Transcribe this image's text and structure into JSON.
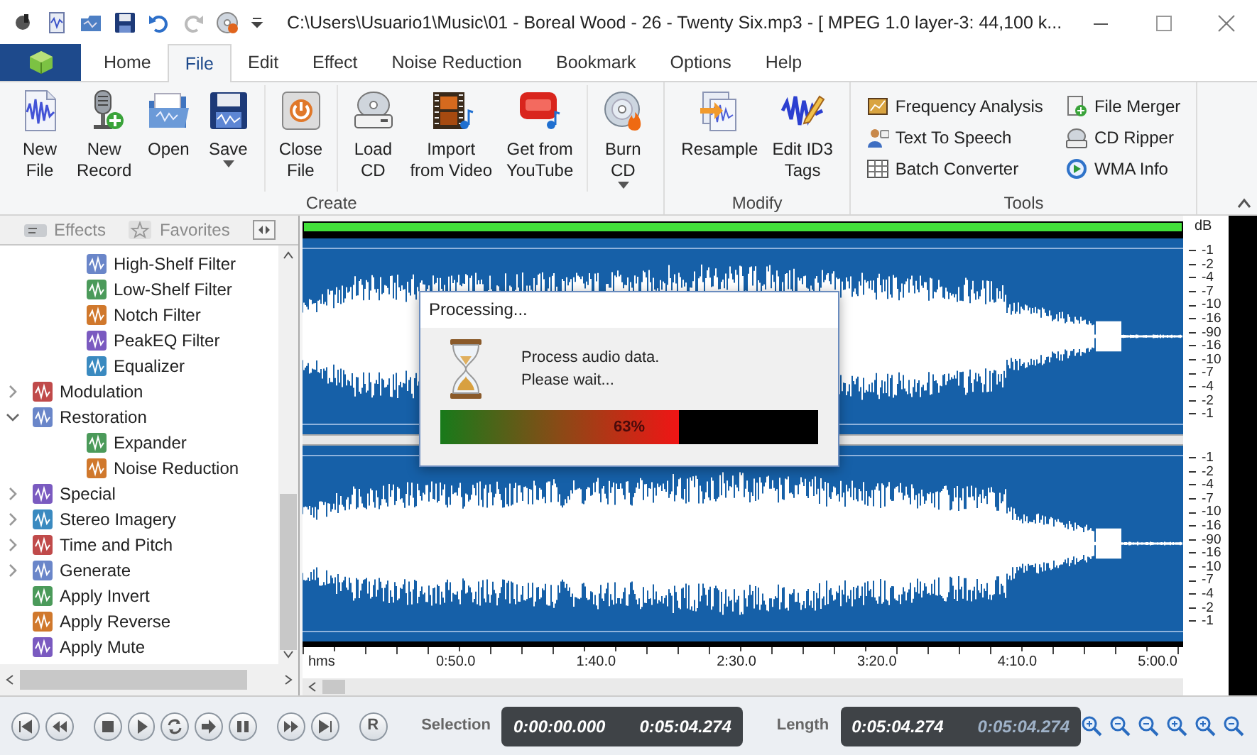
{
  "window": {
    "title": "C:\\Users\\Usuario1\\Music\\01 - Boreal Wood - 26 - Twenty Six.mp3 - [ MPEG 1.0 layer-3: 44,100 k..."
  },
  "tabs": [
    {
      "label": "Home",
      "selected": false
    },
    {
      "label": "File",
      "selected": true
    },
    {
      "label": "Edit",
      "selected": false
    },
    {
      "label": "Effect",
      "selected": false
    },
    {
      "label": "Noise Reduction",
      "selected": false
    },
    {
      "label": "Bookmark",
      "selected": false
    },
    {
      "label": "Options",
      "selected": false
    },
    {
      "label": "Help",
      "selected": false
    }
  ],
  "ribbon": {
    "groups": [
      {
        "label": "Create",
        "sections": [
          [
            {
              "kind": "new-file",
              "lines": [
                "New",
                "File"
              ],
              "dropdown": false
            },
            {
              "kind": "microphone",
              "lines": [
                "New",
                "Record"
              ],
              "dropdown": false
            },
            {
              "kind": "folder",
              "lines": [
                "Open"
              ],
              "dropdown": false
            },
            {
              "kind": "floppy",
              "lines": [
                "Save"
              ],
              "dropdown": true
            }
          ],
          [
            {
              "kind": "power",
              "lines": [
                "Close",
                "File"
              ],
              "dropdown": false
            }
          ],
          [
            {
              "kind": "cd-drive",
              "lines": [
                "Load",
                "CD"
              ],
              "dropdown": false
            },
            {
              "kind": "film",
              "lines": [
                "Import",
                "from Video"
              ],
              "dropdown": false
            },
            {
              "kind": "tube",
              "lines": [
                "Get from",
                "YouTube"
              ],
              "dropdown": false
            }
          ],
          [
            {
              "kind": "burn",
              "lines": [
                "Burn",
                "CD"
              ],
              "dropdown": true
            }
          ]
        ]
      },
      {
        "label": "Modify",
        "sections": [
          [
            {
              "kind": "resample",
              "lines": [
                "Resample"
              ],
              "dropdown": false
            },
            {
              "kind": "tag",
              "lines": [
                "Edit ID3",
                "Tags"
              ],
              "dropdown": false
            }
          ]
        ]
      },
      {
        "label": "Tools",
        "columns": [
          [
            {
              "kind": "chart",
              "label": "Frequency Analysis"
            },
            {
              "kind": "person",
              "label": "Text To Speech"
            },
            {
              "kind": "grid",
              "label": "Batch Converter"
            }
          ],
          [
            {
              "kind": "merge",
              "label": "File Merger"
            },
            {
              "kind": "ripper",
              "label": "CD Ripper"
            },
            {
              "kind": "play",
              "label": "WMA Info"
            }
          ]
        ]
      }
    ]
  },
  "sidebar": {
    "tabs": [
      {
        "label": "Effects"
      },
      {
        "label": "Favorites"
      }
    ],
    "tree": {
      "continued": [
        {
          "label": "High-Shelf Filter"
        },
        {
          "label": "Low-Shelf Filter"
        },
        {
          "label": "Notch Filter"
        },
        {
          "label": "PeakEQ Filter"
        },
        {
          "label": "Equalizer"
        }
      ],
      "items": [
        {
          "label": "Modulation",
          "expanded": false
        },
        {
          "label": "Restoration",
          "expanded": true,
          "children": [
            {
              "label": "Expander"
            },
            {
              "label": "Noise Reduction"
            }
          ]
        },
        {
          "label": "Special",
          "expanded": false
        },
        {
          "label": "Stereo Imagery",
          "expanded": false
        },
        {
          "label": "Time and Pitch",
          "expanded": false
        },
        {
          "label": "Generate",
          "expanded": false
        },
        {
          "label": "Apply Invert"
        },
        {
          "label": "Apply Reverse"
        },
        {
          "label": "Apply Mute"
        }
      ]
    }
  },
  "waveform": {
    "db_unit": "dB",
    "db_scale": [
      [
        "-1",
        "-2",
        "-4",
        "-7",
        "-10",
        "-16",
        "-90",
        "-16",
        "-10",
        "-7",
        "-4",
        "-2",
        "-1"
      ],
      [
        "-1",
        "-2",
        "-4",
        "-7",
        "-10",
        "-16",
        "-90",
        "-16",
        "-10",
        "-7",
        "-4",
        "-2",
        "-1"
      ]
    ],
    "ruler": [
      "hms",
      "0:50.0",
      "1:40.0",
      "2:30.0",
      "3:20.0",
      "4:10.0",
      "5:00.0"
    ]
  },
  "dialog": {
    "title": "Processing...",
    "lines": [
      "Process audio data.",
      "Please wait..."
    ],
    "progress": {
      "level": 0.63,
      "reading": "63%"
    }
  },
  "transport": {
    "record_button": "R",
    "selection": {
      "label": "Selection",
      "values": [
        "0:00:00.000",
        "0:05:04.274"
      ]
    },
    "length": {
      "label": "Length",
      "values": [
        "0:05:04.274",
        "0:05:04.274"
      ]
    }
  }
}
